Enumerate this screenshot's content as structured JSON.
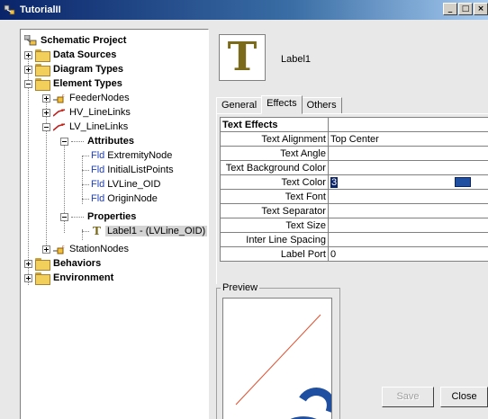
{
  "window": {
    "title": "TutorialII",
    "buttons": [
      "_",
      "□",
      "×"
    ]
  },
  "tree": {
    "items": [
      {
        "label": "Schematic Project",
        "bold": true
      },
      {
        "label": "Data Sources",
        "bold": true
      },
      {
        "label": "Diagram Types",
        "bold": true
      },
      {
        "label": "Element Types",
        "bold": true
      },
      {
        "label": "FeederNodes",
        "bold": false
      },
      {
        "label": "HV_LineLinks",
        "bold": false
      },
      {
        "label": "LV_LineLinks",
        "bold": false
      },
      {
        "label": "Attributes",
        "bold": true
      },
      {
        "label": "ExtremityNode",
        "bold": false
      },
      {
        "label": "InitialListPoints",
        "bold": false
      },
      {
        "label": "LVLine_OID",
        "bold": false
      },
      {
        "label": "OriginNode",
        "bold": false
      },
      {
        "label": "Properties",
        "bold": true
      },
      {
        "label": "Label1 - (LVLine_OID)",
        "bold": false
      },
      {
        "label": "StationNodes",
        "bold": false
      },
      {
        "label": "Behaviors",
        "bold": true
      },
      {
        "label": "Environment",
        "bold": true
      }
    ],
    "fld_prefix": "Fld",
    "t_prefix": "T"
  },
  "label_preview": {
    "icon_glyph": "T",
    "name": "Label1"
  },
  "tabs": [
    {
      "label": "General",
      "active": false
    },
    {
      "label": "Effects",
      "active": true
    },
    {
      "label": "Others",
      "active": false
    }
  ],
  "properties": {
    "header": "Text Effects",
    "rows": [
      {
        "key": "Text Alignment",
        "value": "Top Center"
      },
      {
        "key": "Text Angle",
        "value": ""
      },
      {
        "key": "Text Background Color",
        "value": ""
      },
      {
        "key": "Text Color",
        "value": "3"
      },
      {
        "key": "Text Font",
        "value": ""
      },
      {
        "key": "Text Separator",
        "value": ""
      },
      {
        "key": "Text Size",
        "value": ""
      },
      {
        "key": "Inter Line Spacing",
        "value": ""
      },
      {
        "key": "Label Port",
        "value": "0"
      }
    ],
    "text_color_swatch": "#1f4fa0"
  },
  "preview": {
    "legend": "Preview",
    "line_color": "#e05030",
    "glyph_color": "#1f4fa0"
  },
  "buttons": {
    "save": "Save",
    "close": "Close"
  }
}
